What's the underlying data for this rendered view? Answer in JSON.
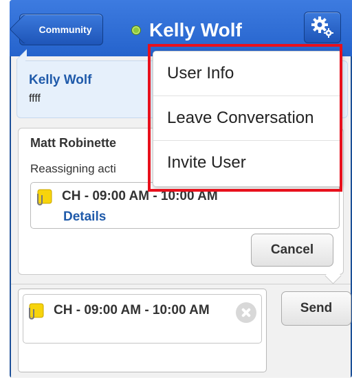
{
  "header": {
    "back_label": "Community",
    "title": "Kelly Wolf",
    "presence": "online",
    "settings_icon": "gear-icon"
  },
  "messages": {
    "peer": {
      "name": "Kelly Wolf",
      "text": "ffff"
    },
    "self": {
      "name": "Matt Robinette",
      "text": "Reassigning acti",
      "attachment": {
        "title": "CH - 09:00 AM - 10:00 AM",
        "link": "Details",
        "icon": "attachment-icon"
      },
      "cancel_label": "Cancel"
    }
  },
  "composer": {
    "attachment_text": "CH - 09:00 AM - 10:00 AM",
    "send_label": "Send",
    "remove_icon": "close-circle-icon"
  },
  "menu": {
    "items": [
      {
        "label": "User Info"
      },
      {
        "label": "Leave Conversation"
      },
      {
        "label": "Invite User"
      }
    ]
  },
  "colors": {
    "header_blue": "#2563cc",
    "link_blue": "#1f5aaa",
    "highlight_red": "#e8101c",
    "presence_green": "#8fc83c"
  }
}
